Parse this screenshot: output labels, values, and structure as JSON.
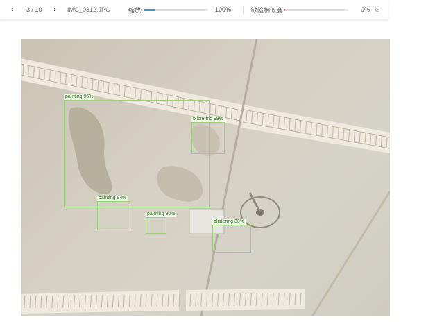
{
  "toolbar": {
    "prev_icon": "chevron-left-icon",
    "next_icon": "chevron-right-icon",
    "counter": "3 / 10",
    "filename": "IMG_0312.JPG",
    "zoom_label": "缩放:",
    "zoom_value": "100%",
    "zoom_fraction": 0.18,
    "similarity_label": "缺陷相似度",
    "similarity_value": "0%",
    "similarity_fraction": 0.02,
    "reset_icon": "close-circle-icon"
  },
  "detections": [
    {
      "label": "painting 96%"
    },
    {
      "label": "blistering 98%"
    },
    {
      "label": "painting 94%"
    },
    {
      "label": "painting 90%"
    },
    {
      "label": "blistering 88%"
    }
  ]
}
